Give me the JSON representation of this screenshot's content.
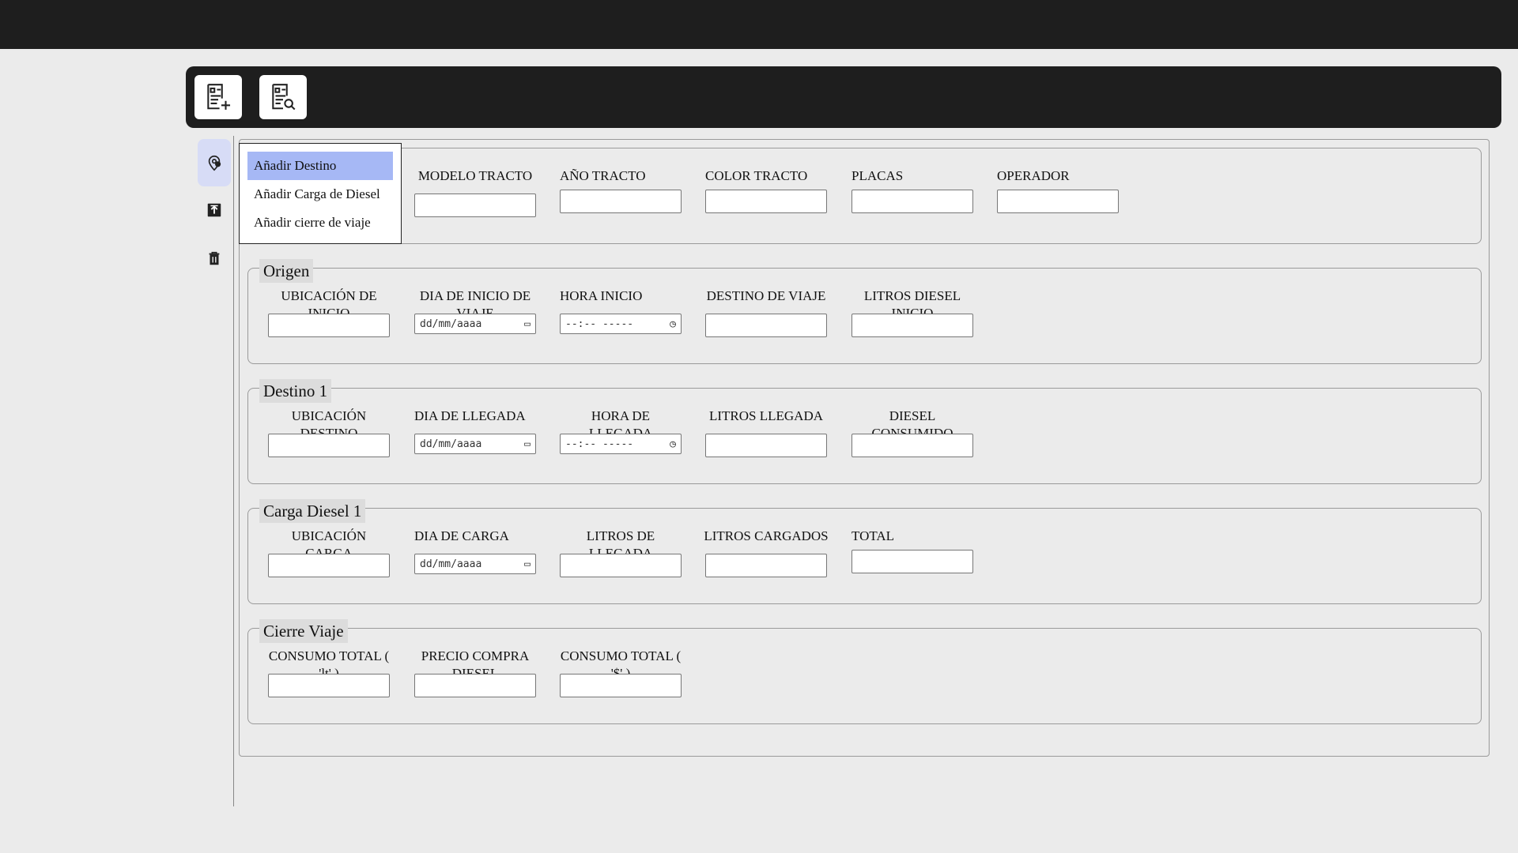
{
  "toolbar": {
    "buttons": [
      {
        "icon": "new-document-icon"
      },
      {
        "icon": "search-document-icon"
      }
    ]
  },
  "sidebar": {
    "icons": [
      "location-pin-icon",
      "upload-icon",
      "trash-icon"
    ]
  },
  "dropdown": {
    "items": [
      "Añadir Destino",
      "Añadir Carga de Diesel",
      "Añadir cierre de viaje"
    ],
    "selected_index": 0
  },
  "header_section": {
    "fields": [
      {
        "label": "MODELO TRACTO",
        "value": ""
      },
      {
        "label": "AÑO TRACTO",
        "value": ""
      },
      {
        "label": "COLOR TRACTO",
        "value": ""
      },
      {
        "label": "PLACAS",
        "value": ""
      },
      {
        "label": "OPERADOR",
        "value": ""
      }
    ]
  },
  "origen": {
    "legend": "Origen",
    "fields": [
      {
        "label": "UBICACIÓN DE INICIO",
        "value": ""
      },
      {
        "label": "DIA DE INICIO DE VIAJE",
        "value": "dd/mm/aaaa"
      },
      {
        "label": "HORA INICIO",
        "value": "--:-- -----"
      },
      {
        "label": "DESTINO DE VIAJE",
        "value": ""
      },
      {
        "label": "LITROS DIESEL INICIO",
        "value": ""
      }
    ]
  },
  "destino": {
    "legend": "Destino 1",
    "fields": [
      {
        "label": "UBICACIÓN DESTINO",
        "value": ""
      },
      {
        "label": "DIA DE LLEGADA",
        "value": "dd/mm/aaaa"
      },
      {
        "label": "HORA DE LLEGADA",
        "value": "--:-- -----"
      },
      {
        "label": "LITROS LLEGADA",
        "value": ""
      },
      {
        "label": "DIESEL CONSUMIDO",
        "value": ""
      }
    ]
  },
  "carga": {
    "legend": "Carga Diesel 1",
    "fields": [
      {
        "label": "UBICACIÓN CARGA",
        "value": ""
      },
      {
        "label": "DIA DE CARGA",
        "value": "dd/mm/aaaa"
      },
      {
        "label": "LITROS DE LLEGADA",
        "value": ""
      },
      {
        "label": "LITROS CARGADOS",
        "value": ""
      },
      {
        "label": "TOTAL",
        "value": ""
      }
    ]
  },
  "cierre": {
    "legend": "Cierre Viaje",
    "fields": [
      {
        "label": "CONSUMO TOTAL ( 'lt' )",
        "value": ""
      },
      {
        "label": "PRECIO COMPRA DIESEL",
        "value": ""
      },
      {
        "label": "CONSUMO TOTAL ( '$' )",
        "value": ""
      }
    ]
  }
}
